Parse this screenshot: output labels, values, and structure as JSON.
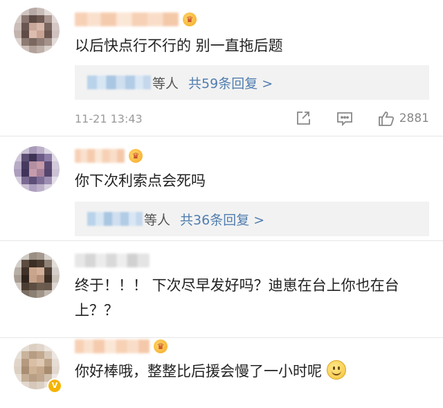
{
  "comments": [
    {
      "text": "以后快点行不行的 别一直拖后题",
      "badge_icon": "crown-badge-icon",
      "reply": {
        "who": "等人",
        "count": "共59条回复 >"
      },
      "time": "11-21 13:43",
      "likes": "2881"
    },
    {
      "text": "你下次利索点会死吗",
      "badge_icon": "crown-badge-icon",
      "reply": {
        "who": "等人",
        "count": "共36条回复 >"
      }
    },
    {
      "text": "终于！！！ 下次尽早发好吗？迪崽在台上你也在台上？？"
    },
    {
      "text": "你好棒哦，整整比后援会慢了一小时呢",
      "badge_icon": "crown-badge-icon",
      "emoji": "smile-emoji-icon"
    }
  ],
  "icons": {
    "forward": "share-icon",
    "comment": "comment-icon",
    "like": "thumbs-up-icon"
  }
}
